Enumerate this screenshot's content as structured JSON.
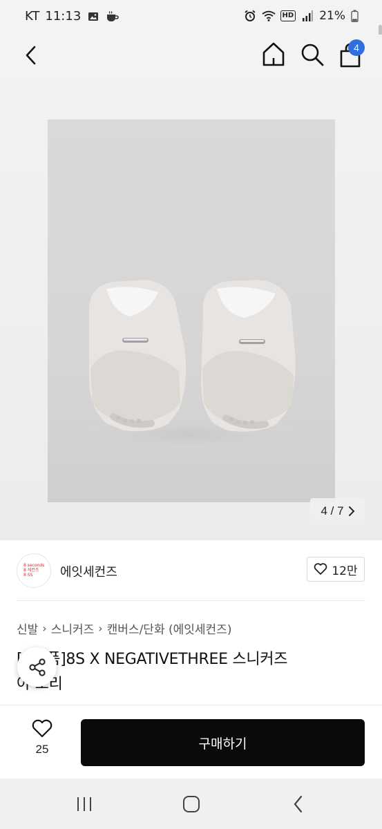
{
  "status_bar": {
    "carrier": "KT",
    "time": "11:13",
    "battery": "21%",
    "hd_label": "HD",
    "left_icons": [
      "image-icon",
      "coffee-icon"
    ],
    "right_icons": [
      "alarm-icon",
      "wifi-icon",
      "hd-icon",
      "signal-icon",
      "battery-icon"
    ]
  },
  "nav": {
    "back_icon": "chevron-left-icon",
    "home_icon": "home-icon",
    "search_icon": "search-icon",
    "bag_icon": "shopping-bag-icon",
    "bag_count": "4",
    "badge_color": "#2f6fde"
  },
  "gallery": {
    "counter": "4 / 7",
    "current_index": 4,
    "total_images": 7,
    "image_alt": "white suede sneakers viewed from behind"
  },
  "seller": {
    "logo_text_lines": [
      "8 seconds",
      "8 세컨즈",
      "8 SS"
    ],
    "name": "에잇세컨즈",
    "likes": "12만"
  },
  "breadcrumb": [
    "신발",
    "스니커즈",
    "캔버스/단화 (에잇세컨즈)"
  ],
  "product": {
    "title_line1": "[   ]반품]8S X NEGATIVETHREE 스니커즈",
    "title_line2": "아  보리"
  },
  "bottom_bar": {
    "wish_count": "25",
    "buy_label": "구매하기"
  },
  "colors": {
    "accent": "#2f6fde",
    "buy_button": "#0a0a0a"
  }
}
